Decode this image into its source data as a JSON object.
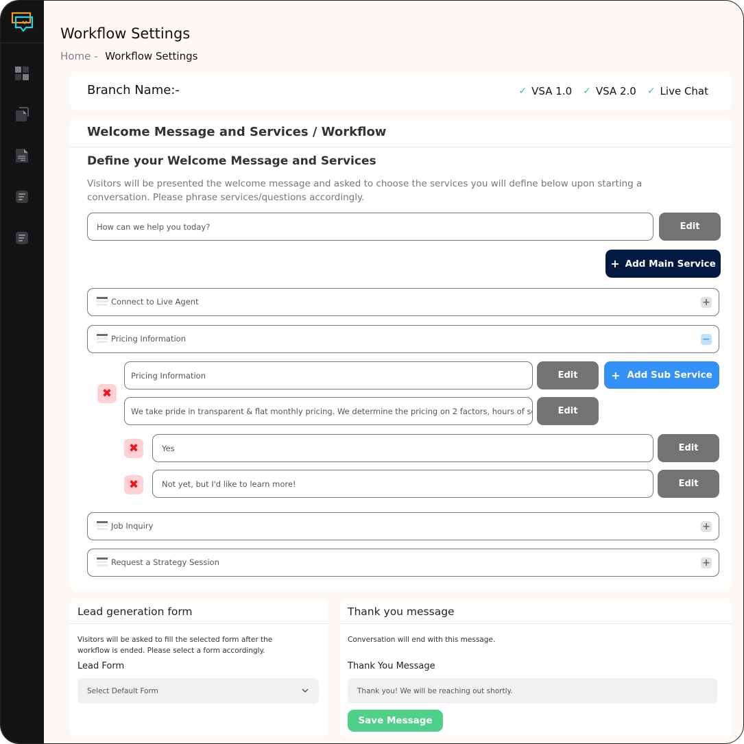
{
  "sidebar": {
    "logo": "chat-bubbles-logo",
    "items": [
      {
        "icon": "dashboard-grid-icon"
      },
      {
        "icon": "copy-document-icon"
      },
      {
        "icon": "text-document-icon"
      },
      {
        "icon": "list-document-icon"
      },
      {
        "icon": "list-document-icon"
      }
    ]
  },
  "header": {
    "title": "Workflow Settings",
    "breadcrumb": {
      "home": "Home -",
      "current": "Workflow Settings"
    }
  },
  "branch": {
    "label": "Branch Name:-",
    "channels": [
      {
        "label": "VSA 1.0",
        "enabled": true
      },
      {
        "label": "VSA 2.0",
        "enabled": true
      },
      {
        "label": "Live Chat",
        "enabled": true
      }
    ]
  },
  "workflow": {
    "heading": "Welcome Message and Services / Workflow",
    "subheading": "Define your Welcome Message and Services",
    "description": "Visitors will be presented the welcome message and asked to choose the services you will define below upon starting a conversation. Please phrase services/questions accordingly.",
    "welcome_message": "How can we help you today?",
    "edit_label": "Edit",
    "add_main_service_label": "Add Main Service",
    "add_sub_service_label": "Add Sub Service",
    "services": [
      {
        "label": "Connect to Live Agent",
        "expanded": false
      },
      {
        "label": "Pricing Information",
        "expanded": true
      },
      {
        "label": "Job Inquiry",
        "expanded": false
      },
      {
        "label": "Request a Strategy Session",
        "expanded": false
      }
    ],
    "expanded_service": {
      "title": "Pricing Information",
      "response": "We take pride in transparent & flat monthly pricing. We determine the pricing on 2 factors, hours of servi",
      "options": [
        "Yes",
        "Not yet, but I'd like to learn more!"
      ]
    }
  },
  "lead_form": {
    "heading": "Lead generation form",
    "description": "Visitors will be asked to fill the selected form after the workflow is ended. Please select a form accordingly.",
    "label": "Lead Form",
    "selected": "Select Default Form"
  },
  "thank_you": {
    "heading": "Thank you message",
    "description": "Conversation will end with this message.",
    "label": "Thank You Message",
    "message": "Thank you! We will be reaching out shortly.",
    "save_label": "Save Message"
  },
  "colors": {
    "sidebar_bg": "#141414",
    "page_bg": "#fdf8f4",
    "primary_dark": "#021a41",
    "primary_blue": "#3391f7",
    "edit_gray": "#737373",
    "success_green": "#4fcf8a",
    "check_green": "#3ec47c",
    "delete_red": "#f01515",
    "delete_bg": "#ffd0d4"
  }
}
